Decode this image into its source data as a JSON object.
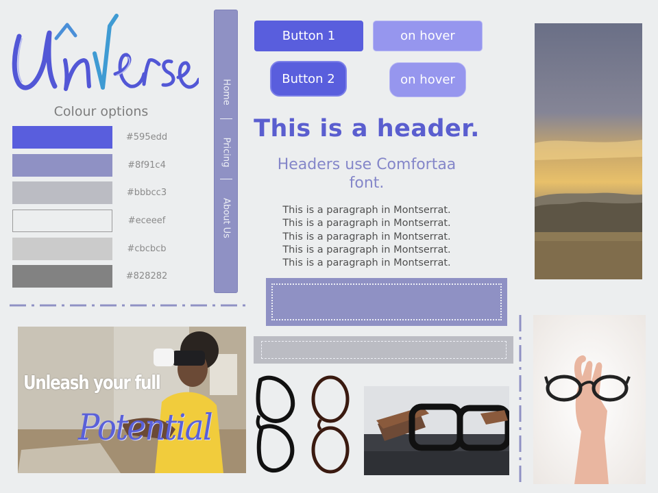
{
  "logo": {
    "text": "Universe"
  },
  "colours": {
    "title": "Colour options",
    "swatches": [
      {
        "color": "#595edd",
        "label": "#595edd"
      },
      {
        "color": "#8f91c4",
        "label": "#8f91c4"
      },
      {
        "color": "#bbbcc3",
        "label": "#bbbcc3"
      },
      {
        "color": "#eceeef",
        "label": "#eceeef"
      },
      {
        "color": "#cbcbcb",
        "label": "#cbcbcb"
      },
      {
        "color": "#828282",
        "label": "#828282"
      }
    ]
  },
  "nav": {
    "items": [
      "Home",
      "Pricing",
      "About Us"
    ]
  },
  "buttons": {
    "button1": "Button 1",
    "hover1": "on hover",
    "button2": "Button 2",
    "hover2": "on hover"
  },
  "typography": {
    "header": "This is a header.",
    "subheader_line1": "Headers use Comfortaa",
    "subheader_line2": "font.",
    "paragraph_lines": [
      "This is a paragraph in Montserrat.",
      "This is a paragraph in Montserrat.",
      "This is a paragraph in Montserrat.",
      "This is a paragraph in Montserrat.",
      "This is a paragraph in Montserrat."
    ]
  },
  "banner": {
    "line1": "Unleash your full",
    "line2": "Potential"
  }
}
